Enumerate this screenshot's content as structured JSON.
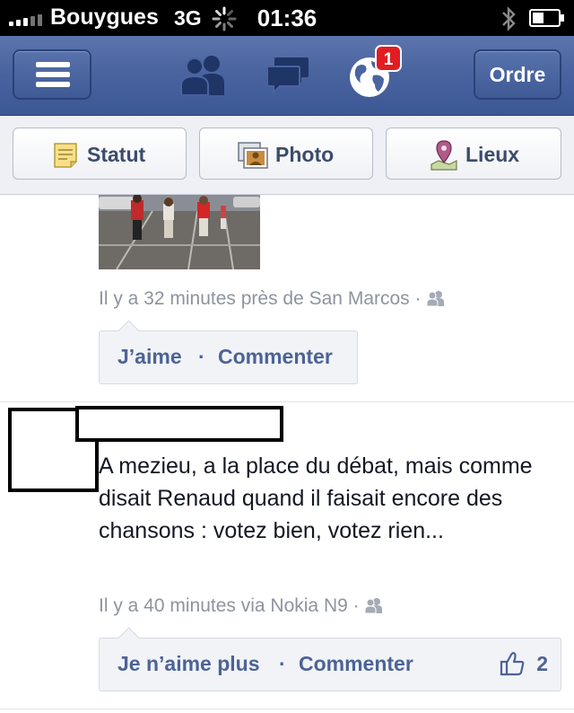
{
  "status_bar": {
    "carrier": "Bouygues",
    "network": "3G",
    "time": "01:36"
  },
  "nav": {
    "menu_icon": "menu-icon",
    "friends_icon": "friends-icon",
    "messages_icon": "messages-icon",
    "notifications_icon": "globe-icon",
    "notification_badge": "1",
    "right_button": "Ordre"
  },
  "publisher": {
    "status_label": "Statut",
    "photo_label": "Photo",
    "places_label": "Lieux"
  },
  "posts": [
    {
      "meta": "Il y a 32 minutes près de San Marcos",
      "separator": "·",
      "actions": {
        "like": "J’aime",
        "dot": "·",
        "comment": "Commenter"
      }
    },
    {
      "body": "A mezieu, a la place du débat, mais comme disait Renaud quand il faisait encore des chansons : votez bien, votez rien...",
      "meta": "Il y a 40 minutes via Nokia N9",
      "separator": "·",
      "actions": {
        "like": "Je n’aime plus",
        "dot": "·",
        "comment": "Commenter"
      },
      "like_count": "2"
    }
  ],
  "colors": {
    "navbar": "#4a64a0",
    "link": "#4c6396",
    "meta": "#8d949e",
    "badge": "#e11d22"
  }
}
